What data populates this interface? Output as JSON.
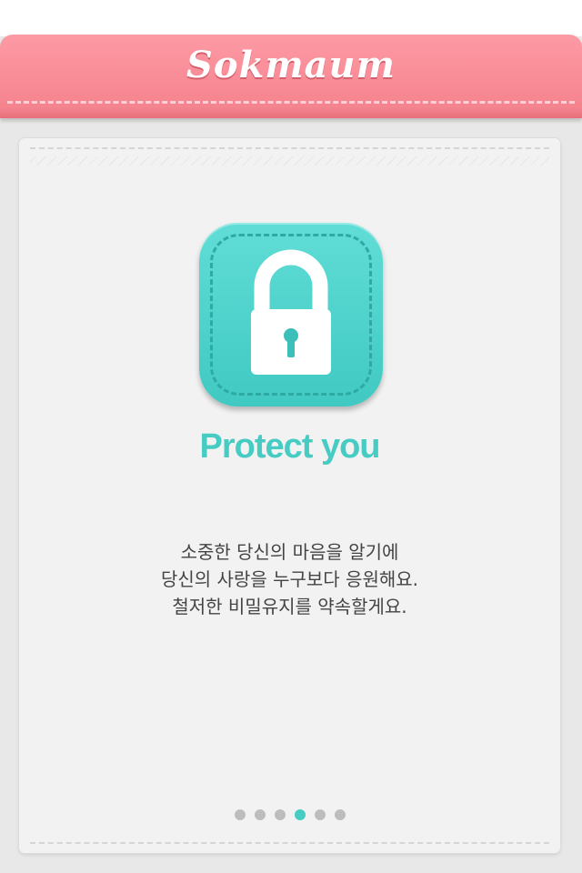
{
  "header": {
    "title": "Sokmaum"
  },
  "slide": {
    "icon": "lock-icon",
    "headline": "Protect you",
    "description": [
      "소중한 당신의 마음을 알기에",
      "당신의 사랑을 누구보다 응원해요.",
      "철저한 비밀유지를 약속할게요."
    ]
  },
  "pager": {
    "total": 6,
    "current": 4
  },
  "colors": {
    "header": "#f4808b",
    "accent": "#47ccc4",
    "dot_inactive": "#bdbdbd"
  }
}
